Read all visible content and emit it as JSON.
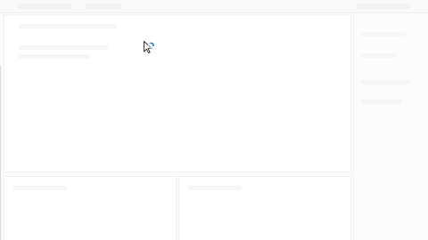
{
  "window": {
    "title": ""
  },
  "cursor": {
    "icon": "busy-cursor-icon"
  },
  "colors": {
    "spinner": "#1a73e8",
    "edge": "#d9d9d9"
  }
}
